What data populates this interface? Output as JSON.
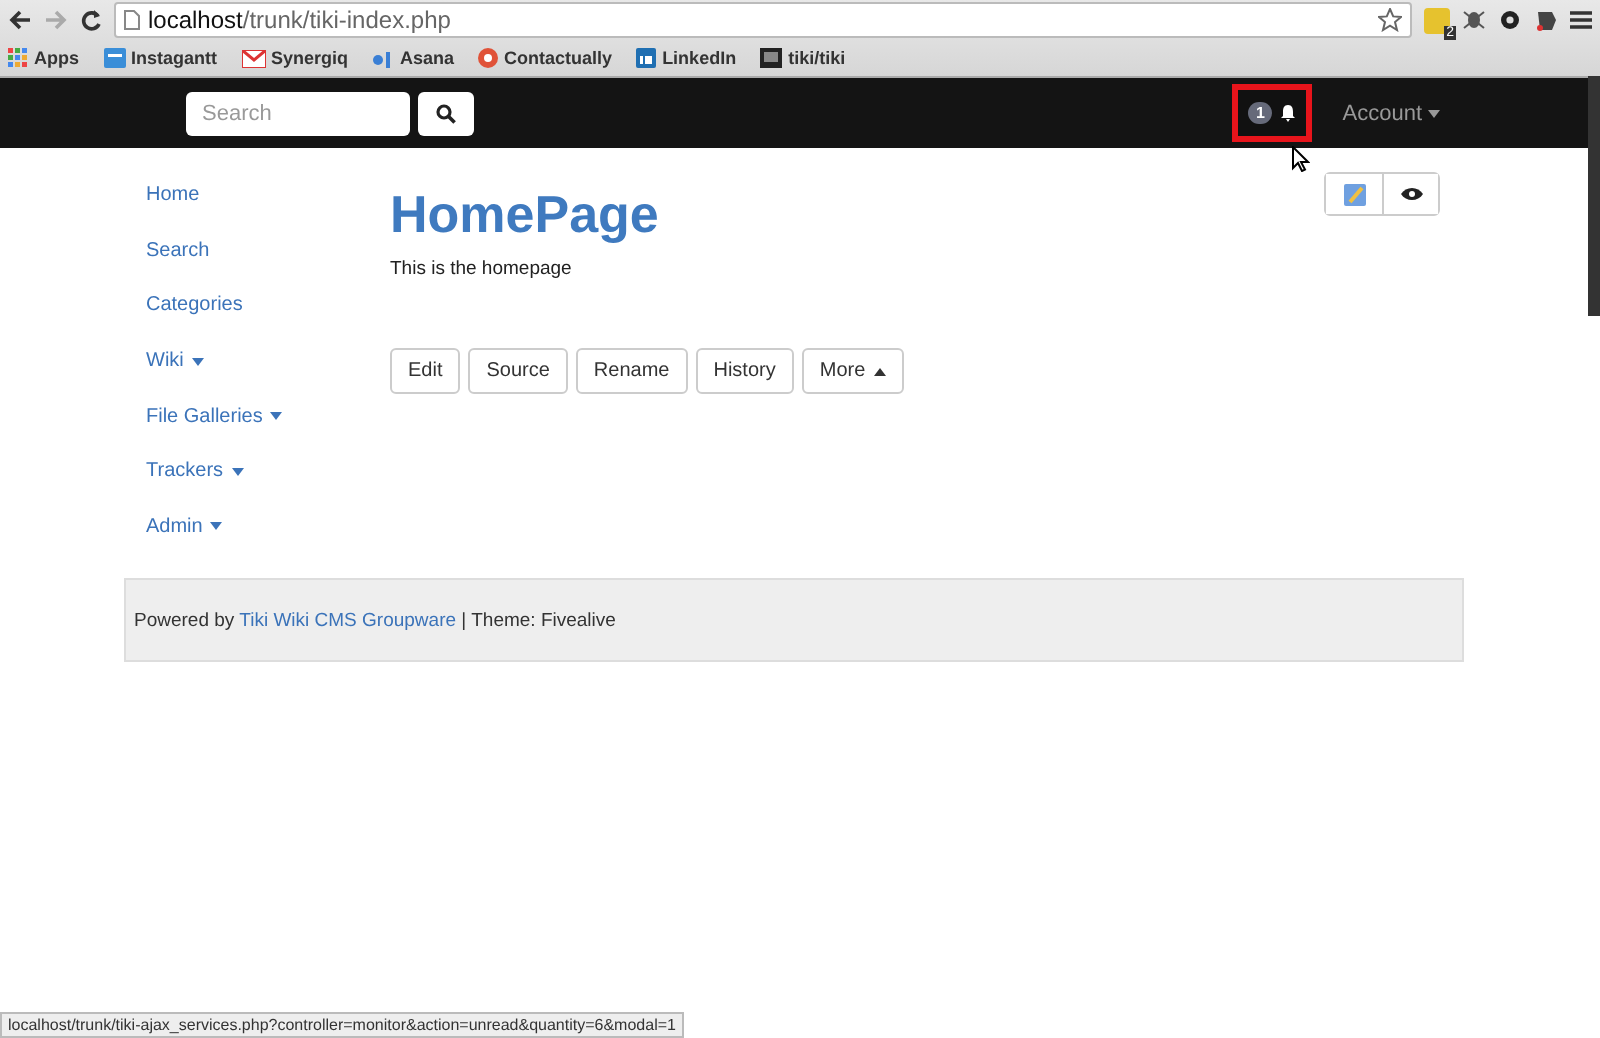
{
  "browser": {
    "address": {
      "host": "localhost",
      "path": "/trunk/tiki-index.php"
    },
    "extension_badge": "2",
    "bookmarks": [
      {
        "label": "Apps"
      },
      {
        "label": "Instagantt"
      },
      {
        "label": "Synergiq"
      },
      {
        "label": "Asana"
      },
      {
        "label": "Contactually"
      },
      {
        "label": "LinkedIn"
      },
      {
        "label": "tiki/tiki"
      }
    ]
  },
  "navbar": {
    "search": {
      "placeholder": "Search"
    },
    "notifications": {
      "count": "1",
      "highlighted": true
    },
    "account": "Account"
  },
  "sidebar": {
    "items": [
      {
        "label": "Home",
        "has_menu": false
      },
      {
        "label": "Search",
        "has_menu": false
      },
      {
        "label": "Categories",
        "has_menu": false
      },
      {
        "label": "Wiki",
        "has_menu": true
      },
      {
        "label": "File Galleries",
        "has_menu": true
      },
      {
        "label": "Trackers",
        "has_menu": true
      },
      {
        "label": "Admin",
        "has_menu": true
      }
    ]
  },
  "page": {
    "title": "HomePage",
    "body": "This is the homepage",
    "actions": [
      {
        "label": "Edit",
        "has_menu": false
      },
      {
        "label": "Source",
        "has_menu": false
      },
      {
        "label": "Rename",
        "has_menu": false
      },
      {
        "label": "History",
        "has_menu": false
      },
      {
        "label": "More",
        "has_menu": true
      }
    ]
  },
  "footer": {
    "prefix": "Powered by",
    "link": "Tiki Wiki CMS Groupware",
    "suffix": "| Theme: Fivealive"
  },
  "status_bar": "localhost/trunk/tiki-ajax_services.php?controller=monitor&action=unread&quantity=6&modal=1"
}
